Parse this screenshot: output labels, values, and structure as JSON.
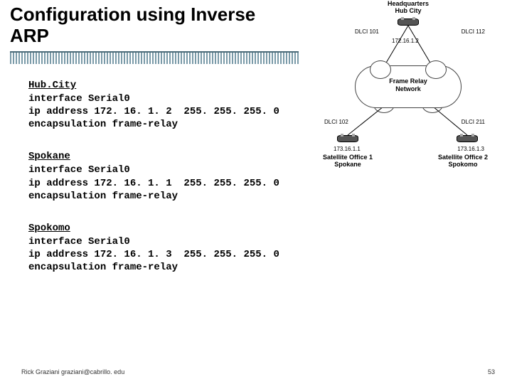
{
  "title": "Configuration using Inverse ARP",
  "configs": [
    {
      "host": "Hub.City",
      "lines": [
        "interface Serial0",
        "ip address 172. 16. 1. 2  255. 255. 255. 0",
        "encapsulation frame-relay"
      ]
    },
    {
      "host": "Spokane",
      "lines": [
        "interface Serial0",
        "ip address 172. 16. 1. 1  255. 255. 255. 0",
        "encapsulation frame-relay"
      ]
    },
    {
      "host": "Spokomo",
      "lines": [
        "interface Serial0",
        "ip address 172. 16. 1. 3  255. 255. 255. 0",
        "encapsulation frame-relay"
      ]
    }
  ],
  "diagram": {
    "hq_label_l1": "Headquarters",
    "hq_label_l2": "Hub City",
    "cloud_l1": "Frame Relay",
    "cloud_l2": "Network",
    "dlci101": "DLCI 101",
    "dlci112": "DLCI 112",
    "dlci102": "DLCI 102",
    "dlci211": "DLCI 211",
    "hub_ip": "172.16.1.2",
    "sat1_ip": "173.16.1.1",
    "sat2_ip": "173.16.1.3",
    "sat1_l1": "Satellite Office 1",
    "sat1_l2": "Spokane",
    "sat2_l1": "Satellite Office 2",
    "sat2_l2": "Spokomo"
  },
  "footer": {
    "author": "Rick Graziani  graziani@cabrillo. edu",
    "page": "53"
  }
}
